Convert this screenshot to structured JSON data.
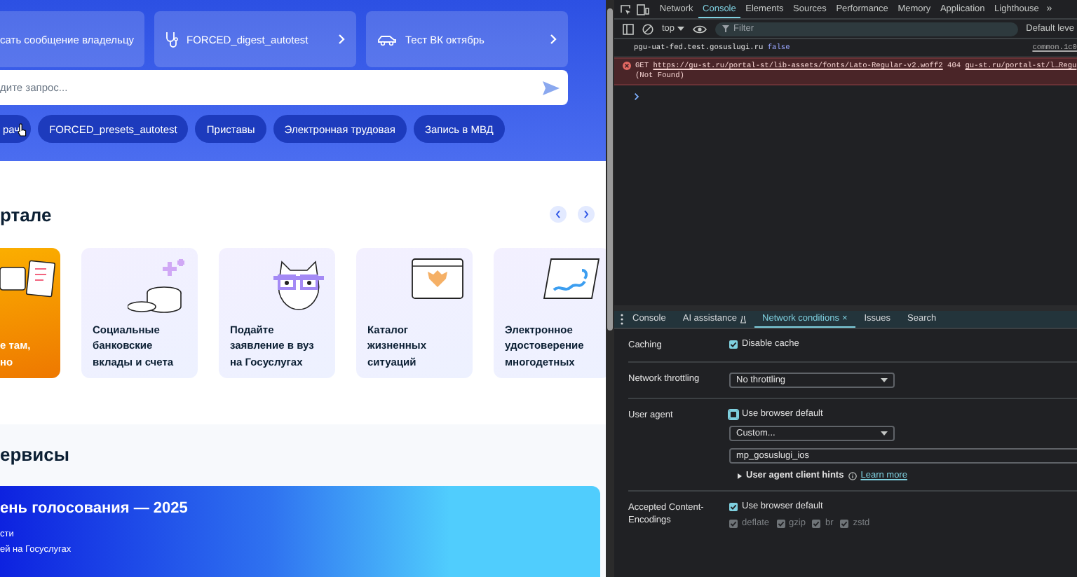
{
  "page": {
    "quick_links": [
      {
        "text": "сать сообщение владельцу"
      },
      {
        "text": "FORCED_digest_autotest"
      },
      {
        "text": "Тест ВК октябрь"
      }
    ],
    "search": {
      "placeholder": "дите запрос..."
    },
    "chips": [
      "рач",
      "FORCED_presets_autotest",
      "Приставы",
      "Электронная трудовая",
      "Запись в МВД"
    ],
    "portal": {
      "heading": "ртале",
      "cards": [
        {
          "kind": "promo",
          "lines": [
            "е там,",
            "но"
          ]
        },
        {
          "kind": "service",
          "lines": [
            "Социальные",
            "банковские",
            "вклады и счета"
          ]
        },
        {
          "kind": "service",
          "lines": [
            "Подайте",
            "заявление в вуз",
            "на Госуслугах"
          ]
        },
        {
          "kind": "service",
          "lines": [
            "Каталог",
            "жизненных",
            "ситуаций"
          ]
        },
        {
          "kind": "service",
          "lines": [
            "Электронное",
            "удостоверение",
            "многодетных"
          ]
        }
      ]
    },
    "services": {
      "heading": "ервисы",
      "banner": {
        "title": "ень голосования — 2025",
        "lines": [
          "сти",
          "ей на Госуслугах"
        ]
      }
    }
  },
  "devtools": {
    "tabs": [
      {
        "label": "Network",
        "selected": false
      },
      {
        "label": "Console",
        "selected": true
      },
      {
        "label": "Elements",
        "selected": false
      },
      {
        "label": "Sources",
        "selected": false
      },
      {
        "label": "Performance",
        "selected": false
      },
      {
        "label": "Memory",
        "selected": false
      },
      {
        "label": "Application",
        "selected": false
      },
      {
        "label": "Lighthouse",
        "selected": false
      }
    ],
    "more": "»",
    "toolbar": {
      "context": "top",
      "filter_placeholder": "Filter",
      "levels": "Default leve"
    },
    "console": [
      {
        "kind": "log",
        "text": "pgu-uat-fed.test.gosuslugi.ru",
        "value": "false",
        "source": "common.1c0"
      },
      {
        "kind": "error",
        "method": "GET",
        "url": "https://gu-st.ru/portal-st/lib-assets/fonts/Lato-Regular-v2.woff2",
        "status": "404",
        "source": "gu-st.ru/portal-st/l…Regu",
        "detail": "(Not Found)"
      }
    ],
    "drawer": {
      "tabs": [
        {
          "label": "Console",
          "selected": false
        },
        {
          "label": "AI assistance",
          "selected": false
        },
        {
          "label": "Network conditions",
          "selected": true,
          "close": "×"
        },
        {
          "label": "Issues",
          "selected": false
        },
        {
          "label": "Search",
          "selected": false
        }
      ],
      "caching": {
        "label": "Caching",
        "checkbox": {
          "label": "Disable cache",
          "checked": true
        }
      },
      "throttling": {
        "label": "Network throttling",
        "value": "No throttling"
      },
      "user_agent": {
        "label": "User agent",
        "checkbox": {
          "label": "Use browser default",
          "checked": false
        },
        "preset": "Custom...",
        "value": "mp_gosuslugi_ios",
        "hints": "User agent client hints",
        "learn_more": "Learn more"
      },
      "encodings": {
        "label": "Accepted Content-Encodings",
        "checkbox": {
          "label": "Use browser default",
          "checked": true
        },
        "options": [
          {
            "label": "deflate",
            "checked": true,
            "disabled": true
          },
          {
            "label": "gzip",
            "checked": true,
            "disabled": true
          },
          {
            "label": "br",
            "checked": true,
            "disabled": true
          },
          {
            "label": "zstd",
            "checked": true,
            "disabled": true
          }
        ]
      }
    }
  }
}
